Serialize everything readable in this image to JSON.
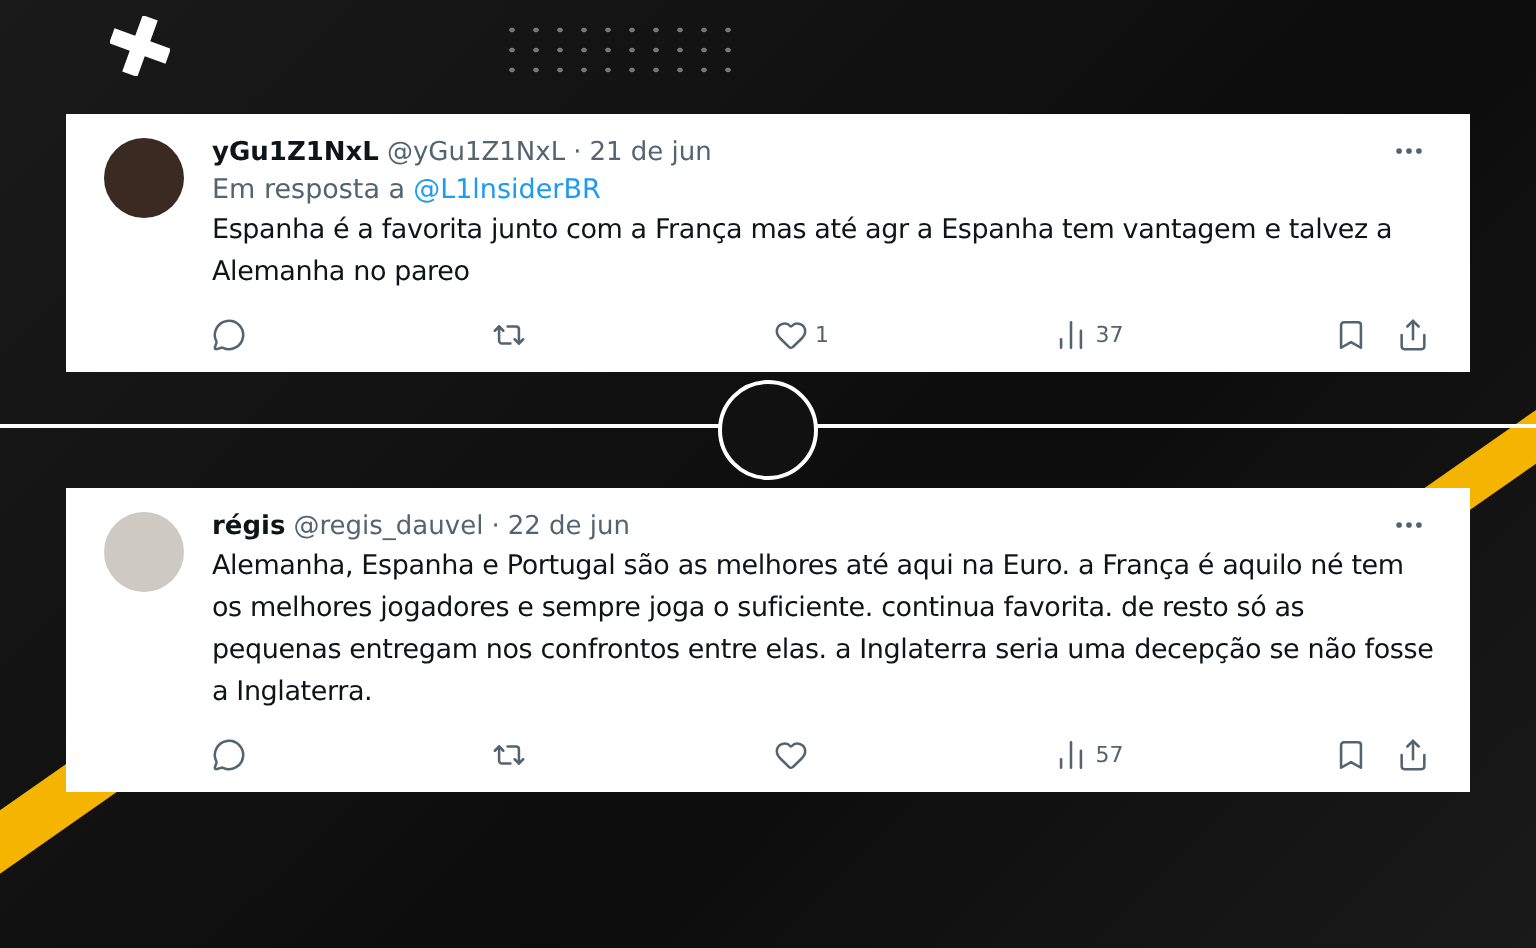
{
  "tweets": [
    {
      "name": "yGu1Z1NxL",
      "handle": "@yGu1Z1NxL",
      "separator": "·",
      "date": "21 de jun",
      "reply_to": {
        "prefix": "Em resposta a",
        "handle": "@L1lnsiderBR"
      },
      "text": "Espanha é a favorita junto com a França mas até agr a Espanha tem vantagem e talvez a Alemanha no pareo",
      "actions": [
        {
          "kind": "reply"
        },
        {
          "kind": "retweet"
        },
        {
          "kind": "like",
          "count": "1"
        },
        {
          "kind": "views",
          "count": "37"
        },
        {
          "kind": "bookmark"
        },
        {
          "kind": "share"
        }
      ]
    },
    {
      "name": "régis",
      "handle": "@regis_dauvel",
      "separator": "·",
      "date": "22 de jun",
      "text": "Alemanha, Espanha e Portugal são as melhores até aqui na Euro. a França é aquilo né tem os melhores jogadores e sempre joga o suficiente. continua favorita. de resto só as pequenas entregam nos confrontos entre elas. a Inglaterra seria uma decepção se não fosse a Inglaterra.",
      "actions": [
        {
          "kind": "reply"
        },
        {
          "kind": "retweet"
        },
        {
          "kind": "like"
        },
        {
          "kind": "views",
          "count": "57"
        },
        {
          "kind": "bookmark"
        },
        {
          "kind": "share"
        }
      ]
    }
  ]
}
